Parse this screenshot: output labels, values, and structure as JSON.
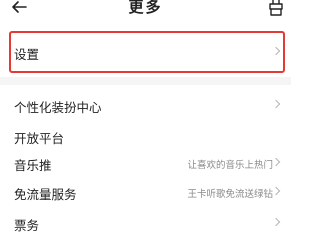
{
  "header": {
    "title": "更多"
  },
  "settings_row": {
    "label": "设置"
  },
  "menu": [
    {
      "label": "个性化装扮中心",
      "value": "",
      "chevron": true
    },
    {
      "label": "开放平台",
      "value": "",
      "chevron": false
    },
    {
      "label": "音乐推",
      "value": "让喜欢的音乐上热门",
      "chevron": true
    },
    {
      "label": "免流量服务",
      "value": "王卡听歌免流送绿钻",
      "chevron": true
    },
    {
      "label": "票务",
      "value": "",
      "chevron": true
    }
  ],
  "colors": {
    "highlight_border": "#e53935",
    "section_gap": "#f5f5f5"
  }
}
